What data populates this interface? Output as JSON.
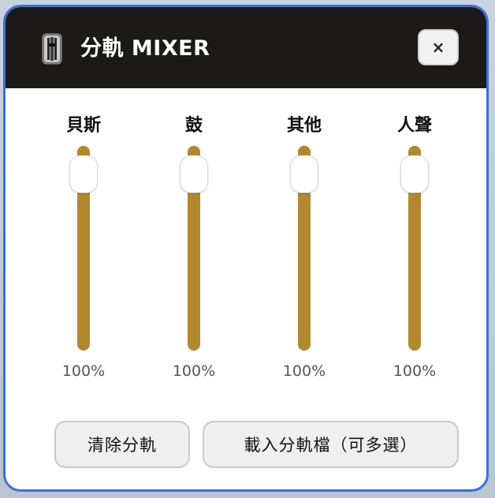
{
  "dialog": {
    "title": "分軌 MIXER",
    "header_icon": "mixer-slider-icon",
    "close_label": "×"
  },
  "channels": [
    {
      "label": "貝斯",
      "value": "100%",
      "level": 1.0
    },
    {
      "label": "鼓",
      "value": "100%",
      "level": 1.0
    },
    {
      "label": "其他",
      "value": "100%",
      "level": 1.0
    },
    {
      "label": "人聲",
      "value": "100%",
      "level": 1.0
    }
  ],
  "actions": {
    "clear_label": "清除分軌",
    "load_label": "載入分軌檔（可多選）"
  },
  "colors": {
    "header_bg": "#1b1a19",
    "track": "#b3872f",
    "border": "#3d6fd8"
  }
}
